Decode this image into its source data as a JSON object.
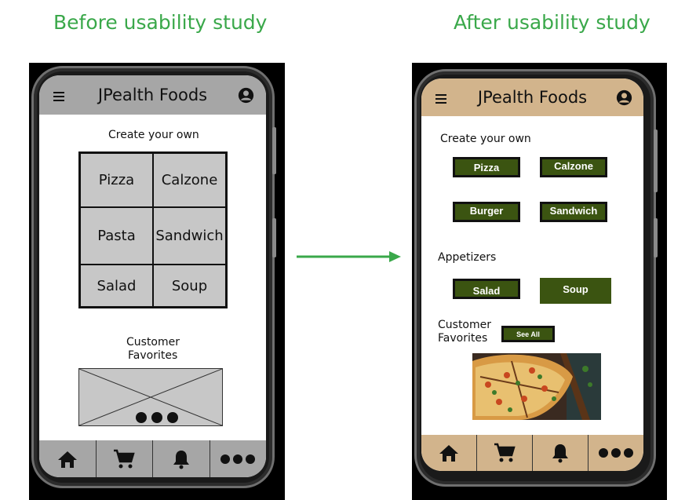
{
  "headings": {
    "before": "Before usability study",
    "after": "After usability study"
  },
  "before": {
    "app_title": "JPealth Foods",
    "create_label": "Create your own",
    "menu_items": [
      "Pizza",
      "Calzone",
      "Pasta",
      "Sandwich",
      "Salad",
      "Soup"
    ],
    "favorites_label": [
      "Customer",
      "Favorites"
    ],
    "colors": {
      "topbar": "#a6a6a6",
      "navbar": "#a6a6a6",
      "cells": "#c7c7c7"
    },
    "nav_icons": [
      "home-icon",
      "cart-icon",
      "bell-icon",
      "more-icon"
    ]
  },
  "after": {
    "app_title": "JPealth Foods",
    "create_label": "Create your own",
    "create_items": [
      "Pizza",
      "Calzone",
      "Burger",
      "Sandwich"
    ],
    "appetizers_label": "Appetizers",
    "appetizer_items": [
      "Salad",
      "Soup"
    ],
    "favorites_label": [
      "Customer",
      "Favorites"
    ],
    "see_all_label": "See All",
    "colors": {
      "topbar": "#d2b48c",
      "navbar": "#d2b48c",
      "button": "#3b5411",
      "arrow": "#3aa84a"
    },
    "nav_icons": [
      "home-icon",
      "cart-icon",
      "bell-icon",
      "more-icon"
    ]
  }
}
